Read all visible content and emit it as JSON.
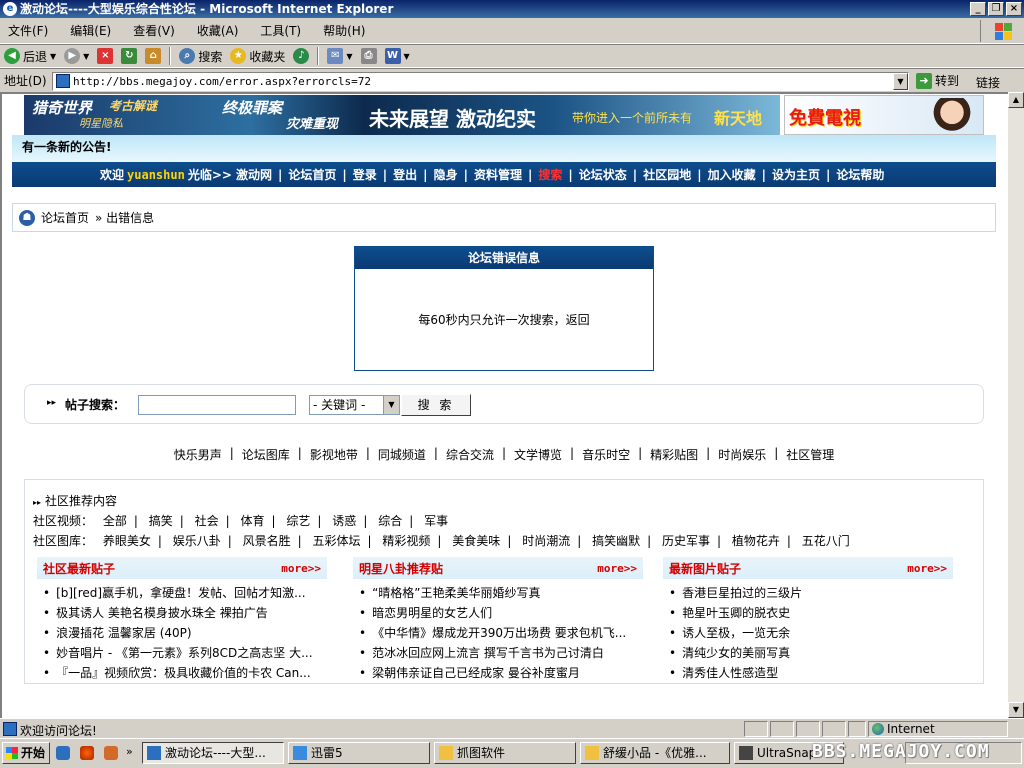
{
  "window": {
    "title": "激动论坛----大型娱乐综合性论坛 - Microsoft Internet Explorer"
  },
  "menu": [
    "文件(F)",
    "编辑(E)",
    "查看(V)",
    "收藏(A)",
    "工具(T)",
    "帮助(H)"
  ],
  "toolbar": {
    "back": "后退",
    "search": "搜索",
    "favorites": "收藏夹"
  },
  "address": {
    "label": "地址(D)",
    "url": "http://bbs.megajoy.com/error.aspx?errorcls=72",
    "go": "转到",
    "links": "链接"
  },
  "banner": {
    "t1": "猎奇世界",
    "t2": "考古解谜",
    "t3": "明星隐私",
    "t4": "终极罪案",
    "t5": "灾难重现",
    "t6": "未来展望 激动纪实",
    "t7": "带你进入一个前所未有",
    "t8": "新天地",
    "ad": "免費電視"
  },
  "notice": "有一条新的公告!",
  "nav": {
    "welcome": "欢迎",
    "user": "yuanshun",
    "visit": "光临>>",
    "items": [
      "激动网",
      "论坛首页",
      "登录",
      "登出",
      "隐身",
      "资料管理",
      "搜索",
      "论坛状态",
      "社区园地",
      "加入收藏",
      "设为主页",
      "论坛帮助"
    ]
  },
  "breadcrumb": {
    "home": "论坛首页",
    "current": "» 出错信息"
  },
  "error": {
    "title": "论坛错误信息",
    "message": "每60秒内只允许一次搜索，返回"
  },
  "search": {
    "label": "帖子搜索：",
    "select": "- 关键词 -",
    "button": "搜 索"
  },
  "categories": [
    "快乐男声",
    "论坛图库",
    "影视地带",
    "同城频道",
    "综合交流",
    "文学博览",
    "音乐时空",
    "精彩贴图",
    "时尚娱乐",
    "社区管理"
  ],
  "recommend": {
    "title": "社区推荐内容",
    "video_label": "社区视频：",
    "video": [
      "全部",
      "搞笑",
      "社会",
      "体育",
      "综艺",
      "诱惑",
      "综合",
      "军事"
    ],
    "gallery_label": "社区图库：",
    "gallery": [
      "养眼美女",
      "娱乐八卦",
      "风景名胜",
      "五彩体坛",
      "精彩视频",
      "美食美味",
      "时尚潮流",
      "搞笑幽默",
      "历史军事",
      "植物花卉",
      "五花八门"
    ],
    "more": "more>>",
    "columns": [
      {
        "title": "社区最新贴子",
        "items": [
          "[b][red]赢手机，拿硬盘！发帖、回帖才知激...",
          "极其诱人 美艳名模身披水珠全 裸拍广告",
          "浪漫插花 温馨家居 (40P)",
          "妙音唱片 - 《第一元素》系列8CD之高志坚 大...",
          "『一品』视频欣赏：极具收藏价值的卡农 Can..."
        ]
      },
      {
        "title": "明星八卦推荐贴",
        "items": [
          "“晴格格”王艳柔美华丽婚纱写真",
          "暗恋男明星的女艺人们",
          "《中华情》爆成龙开390万出场费 要求包机飞...",
          "范冰冰回应网上流言 撰写千言书为己讨清白",
          "梁朝伟亲证自己已经成家 曼谷补度蜜月"
        ]
      },
      {
        "title": "最新图片贴子",
        "items": [
          "香港巨星拍过的三级片",
          "艳星叶玉卿的脱衣史",
          "诱人至极，一览无余",
          "清纯少女的美丽写真",
          "清秀佳人性感造型"
        ]
      }
    ]
  },
  "status": {
    "text": "欢迎访问论坛!",
    "zone": "Internet"
  },
  "taskbar": {
    "start": "开始",
    "tasks": [
      "激动论坛----大型...",
      "迅雷5",
      "抓图软件",
      "舒缓小品 -《优雅...",
      "UltraSnap"
    ],
    "watermark": "BBS.MEGAJOY.COM"
  }
}
